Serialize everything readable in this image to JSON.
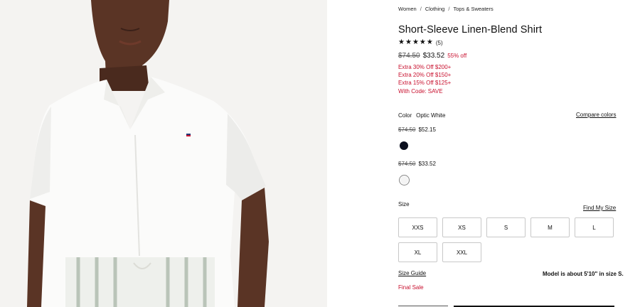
{
  "breadcrumb": [
    "Women",
    "Clothing",
    "Tops & Sweaters"
  ],
  "product": {
    "title": "Short-Sleeve Linen-Blend Shirt",
    "rating_stars": 5,
    "review_count": "(5)",
    "original_price": "$74.50",
    "sale_price": "$33.52",
    "discount": "55% off",
    "promos": [
      "Extra 30% Off $200+",
      "Extra 20% Off $150+",
      "Extra 15% Off $125+",
      "With Code: SAVE"
    ]
  },
  "color": {
    "label": "Color",
    "selected": "Optic White",
    "compare_link": "Compare colors",
    "variants": [
      {
        "original_price": "$74.50",
        "sale_price": "$52.15",
        "swatch_color": "#0b0f1e"
      },
      {
        "original_price": "$74.50",
        "sale_price": "$33.52",
        "swatch_color": "#f4f4f4"
      }
    ]
  },
  "size": {
    "label": "Size",
    "find_link": "Find My Size",
    "options": [
      "XXS",
      "XS",
      "S",
      "M",
      "L",
      "XL",
      "XXL"
    ],
    "guide_link": "Size Guide",
    "model_note": "Model is about 5'10\" in size S."
  },
  "final_sale": "Final Sale",
  "accent_red": "#c8102e"
}
